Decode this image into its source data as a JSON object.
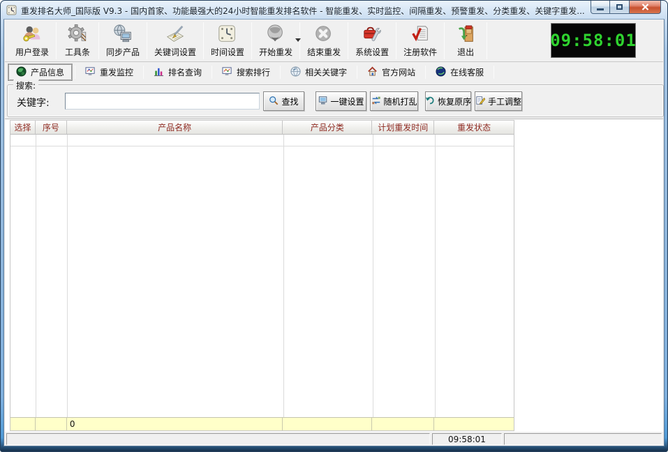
{
  "window": {
    "title": "重发排名大师_国际版 V9.3 - 国内首家、功能最强大的24小时智能重发排名软件 - 智能重发、实时监控、间隔重发、预警重发、分类重发、关键字重发...",
    "app_icon": "clock-app-icon"
  },
  "toolbar": {
    "items": [
      {
        "label": "用户登录",
        "icon": "users-key-icon"
      },
      {
        "label": "工具条",
        "icon": "gear-icon"
      },
      {
        "label": "同步产品",
        "icon": "globe-computer-icon"
      },
      {
        "label": "关键词设置",
        "icon": "pen-paper-icon"
      },
      {
        "label": "时间设置",
        "icon": "clock-icon"
      },
      {
        "label": "开始重发",
        "icon": "globe-start-icon",
        "has_dropdown": true
      },
      {
        "label": "结束重发",
        "icon": "stop-x-icon"
      },
      {
        "label": "系统设置",
        "icon": "toolbox-wrench-icon"
      },
      {
        "label": "注册软件",
        "icon": "register-check-icon"
      },
      {
        "label": "退出",
        "icon": "exit-door-icon"
      }
    ],
    "clock": "09:58:01",
    "clock_color": "#2fd32f"
  },
  "tabs": {
    "items": [
      {
        "label": "产品信息",
        "icon": "globe-green-icon",
        "selected": true
      },
      {
        "label": "重发监控",
        "icon": "monitor-chart-icon",
        "selected": false
      },
      {
        "label": "排名查询",
        "icon": "bar-chart-icon",
        "selected": false
      },
      {
        "label": "搜索排行",
        "icon": "monitor-chart-icon",
        "selected": false
      },
      {
        "label": "相关关键字",
        "icon": "globe-light-icon",
        "selected": false
      },
      {
        "label": "官方网站",
        "icon": "home-icon",
        "selected": false
      },
      {
        "label": "在线客服",
        "icon": "globe-dark-icon",
        "selected": false
      }
    ]
  },
  "search": {
    "group_label": "搜索:",
    "keyword_label": "关键字:",
    "input_value": "",
    "buttons": [
      {
        "label": "查找",
        "icon": "magnifier-icon"
      },
      {
        "label": "一键设置",
        "icon": "monitor-small-icon"
      },
      {
        "label": "随机打乱",
        "icon": "shuffle-icon"
      },
      {
        "label": "恢复原序",
        "icon": "undo-icon"
      },
      {
        "label": "手工调整",
        "icon": "edit-icon"
      }
    ]
  },
  "table": {
    "headers": [
      "选择",
      "序号",
      "产品名称",
      "产品分类",
      "计划重发时间",
      "重发状态"
    ],
    "header_text_color": "#8f2b22",
    "rows": [],
    "footer_count": "0",
    "footer_bg": "#ffffc9"
  },
  "statusbar": {
    "panels": [
      "",
      "09:58:01",
      ""
    ]
  },
  "colors": {
    "frame_blue": "#8fb6dc",
    "close_button_red": "#c8502f",
    "client_bg": "#f0f0f0",
    "clock_bg": "#060606"
  }
}
